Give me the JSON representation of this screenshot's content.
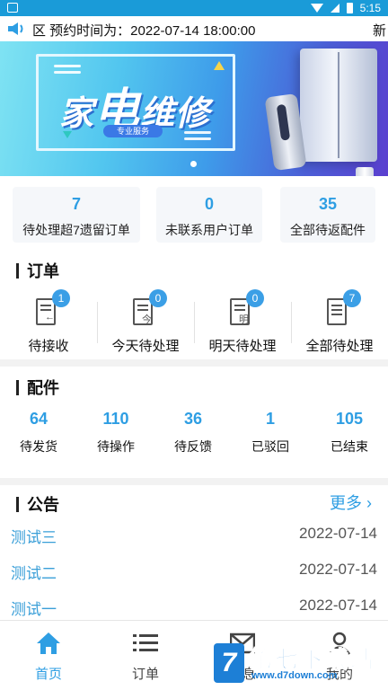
{
  "status_bar": {
    "time": "5:15"
  },
  "marquee": {
    "text": "区 预约时间为：2022-07-14 18:00:00",
    "tail": "新"
  },
  "banner": {
    "title_a": "家",
    "title_b": "电",
    "title_c": "维修",
    "tag": "专业服务"
  },
  "stats": [
    {
      "value": "7",
      "label": "待处理超7遗留订单"
    },
    {
      "value": "0",
      "label": "未联系用户订单"
    },
    {
      "value": "35",
      "label": "全部待返配件"
    }
  ],
  "orders": {
    "heading": "订单",
    "items": [
      {
        "badge": "1",
        "glyph": "←",
        "label": "待接收"
      },
      {
        "badge": "0",
        "glyph": "今",
        "label": "今天待处理"
      },
      {
        "badge": "0",
        "glyph": "明",
        "label": "明天待处理"
      },
      {
        "badge": "7",
        "glyph": "",
        "label": "全部待处理"
      }
    ]
  },
  "parts": {
    "heading": "配件",
    "items": [
      {
        "value": "64",
        "label": "待发货"
      },
      {
        "value": "110",
        "label": "待操作"
      },
      {
        "value": "36",
        "label": "待反馈"
      },
      {
        "value": "1",
        "label": "已驳回"
      },
      {
        "value": "105",
        "label": "已结束"
      }
    ]
  },
  "notices": {
    "heading": "公告",
    "more": "更多 ›",
    "items": [
      {
        "title": "测试三",
        "date": "2022-07-14"
      },
      {
        "title": "测试二",
        "date": "2022-07-14"
      },
      {
        "title": "测试一",
        "date": "2022-07-14"
      }
    ]
  },
  "tabs": [
    {
      "label": "首页",
      "icon": "home-icon"
    },
    {
      "label": "订单",
      "icon": "list-icon"
    },
    {
      "label": "消息",
      "icon": "mail-icon"
    },
    {
      "label": "我的",
      "icon": "user-icon"
    }
  ],
  "watermark": {
    "brand": "第七下载站",
    "url": "www.d7down.com"
  },
  "colors": {
    "accent": "#2e9ee3",
    "statusbar": "#1a9bd8"
  }
}
